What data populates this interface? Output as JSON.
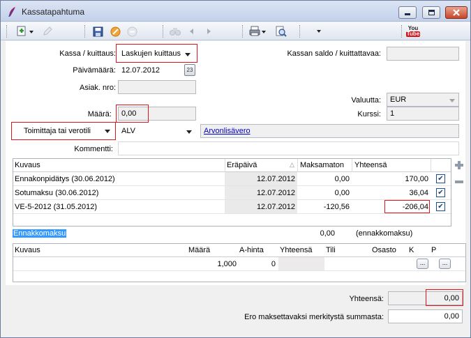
{
  "window": {
    "title": "Kassatapahtuma"
  },
  "toolbar": {
    "icons": [
      "new-icon",
      "edit-icon",
      "save-icon",
      "cancel-icon",
      "delete-icon",
      "find-icon",
      "prev-icon",
      "next-icon",
      "print-icon",
      "preview-icon",
      "more-icon",
      "youtube-icon"
    ],
    "youtube_label": "You",
    "youtube_label2": "Tube"
  },
  "form": {
    "kassa_label": "Kassa / kuittaus:",
    "kassa_value": "Laskujen kuittaus",
    "paivamaara_label": "Päivämäärä:",
    "paivamaara_value": "12.07.2012",
    "calendar_label": "23",
    "asiak_label": "Asiak. nro:",
    "asiak_value": "",
    "maara_label": "Määrä:",
    "maara_value": "0,00",
    "toimittaja_label": "Toimittaja tai verotili",
    "toimittaja_value": "ALV",
    "toimittaja_link": "Arvonlisävero",
    "kommentti_label": "Kommentti:",
    "kommentti_value": "",
    "saldo_label": "Kassan saldo / kuittattavaa:",
    "saldo_value": "",
    "valuutta_label": "Valuutta:",
    "valuutta_value": "EUR",
    "kurssi_label": "Kurssi:",
    "kurssi_value": "1"
  },
  "invoices": {
    "headers": [
      "Kuvaus",
      "Eräpäivä",
      "Maksamaton",
      "Yhteensä"
    ],
    "rows": [
      {
        "kuvaus": "Ennakonpidätys (30.06.2012)",
        "erapaiva": "12.07.2012",
        "maksamaton": "0,00",
        "yhteensa": "170,00",
        "checked": "✔"
      },
      {
        "kuvaus": "Sotumaksu (30.06.2012)",
        "erapaiva": "12.07.2012",
        "maksamaton": "0,00",
        "yhteensa": "36,04",
        "checked": "✔"
      },
      {
        "kuvaus": "VE-5-2012 (31.05.2012)",
        "erapaiva": "12.07.2012",
        "maksamaton": "-120,56",
        "yhteensa": "-206,04",
        "checked": "✔"
      }
    ]
  },
  "advance": {
    "label": "Ennakkomaksu",
    "value": "0,00",
    "note": "(ennakkomaksu)"
  },
  "lines": {
    "headers": [
      "Kuvaus",
      "Määrä",
      "A-hinta",
      "Yhteensä",
      "Tili",
      "Osasto",
      "K",
      "P"
    ],
    "row": {
      "kuvaus": "",
      "maara": "1,000",
      "ahinta": "0",
      "yhteensa": "",
      "tili": "",
      "osasto": "",
      "k_btn": "...",
      "p_btn": "..."
    }
  },
  "totals": {
    "yhteensa_label": "Yhteensä:",
    "yhteensa_value": "0,00",
    "ero_label": "Ero maksettavaksi merkitystä summasta:",
    "ero_value": "0,00"
  },
  "side": {
    "add": "+",
    "remove": "−"
  }
}
